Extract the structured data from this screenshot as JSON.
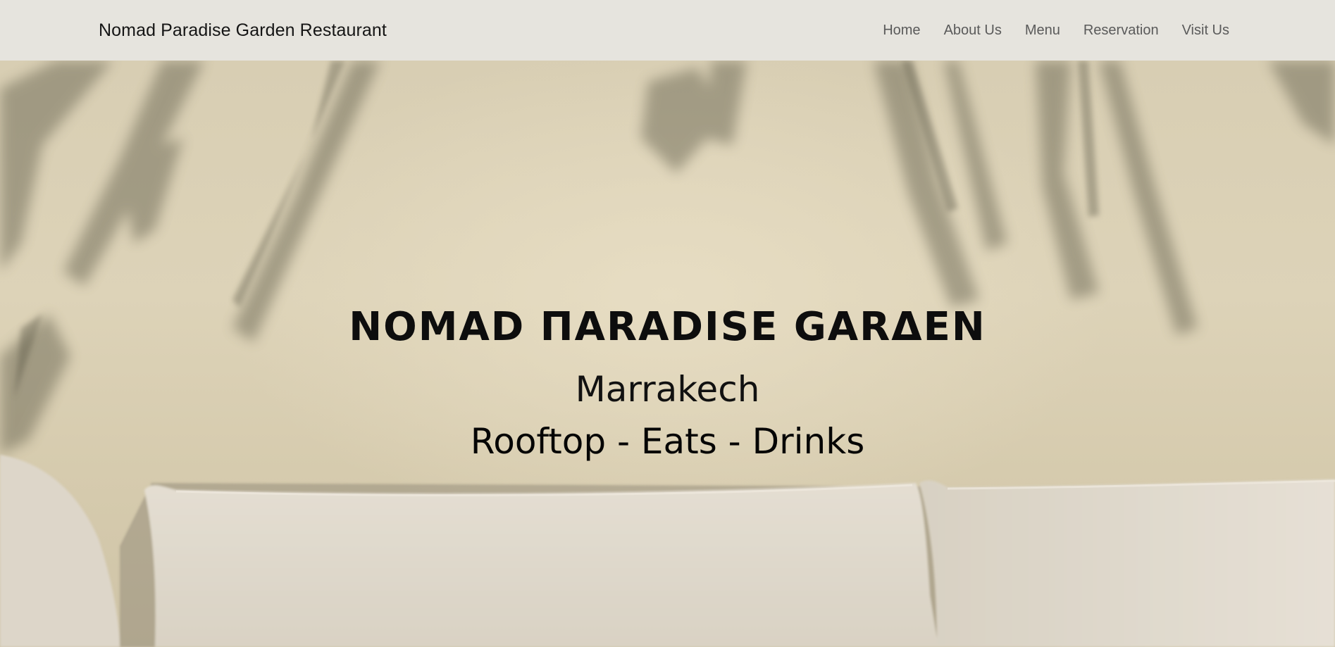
{
  "navbar": {
    "brand": "Nomad Paradise Garden Restaurant",
    "links": [
      {
        "label": "Home"
      },
      {
        "label": "About Us"
      },
      {
        "label": "Menu"
      },
      {
        "label": "Reservation"
      },
      {
        "label": "Visit Us"
      }
    ]
  },
  "hero": {
    "title": "NOMAD ΠARADISE GARΔEN",
    "city": "Marrakech",
    "tagline": "Rooftop - Eats - Drinks"
  },
  "colors": {
    "navbar_bg": "#e6e4de",
    "hero_wall": "#d8ceb3",
    "cushion": "#e2dcd0",
    "text_dark": "#0d0d0d",
    "nav_link": "#5a5a5a"
  }
}
